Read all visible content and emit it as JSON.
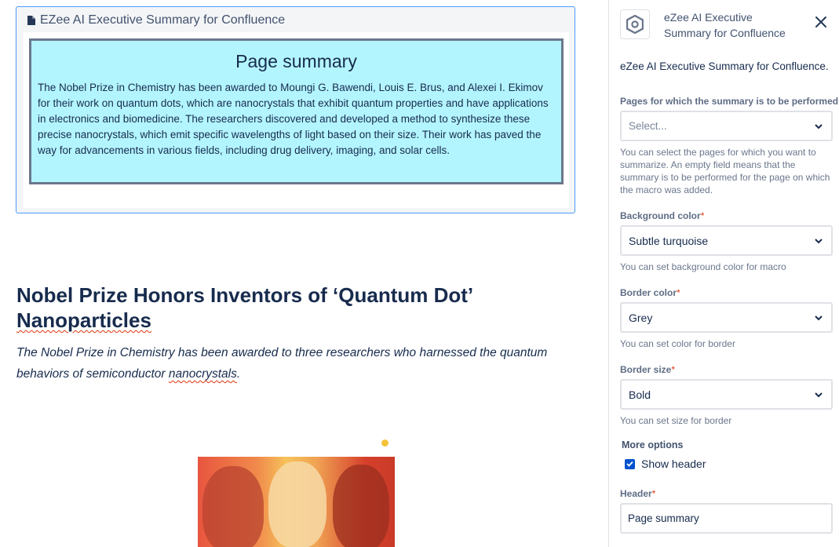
{
  "editor": {
    "macro_title": "EZee AI Executive Summary for Confluence",
    "summary_heading": "Page summary",
    "summary_text": "The Nobel Prize in Chemistry has been awarded to Moungi G. Bawendi, Louis E. Brus, and Alexei I. Ekimov for their work on quantum dots, which are nanocrystals that exhibit quantum properties and have applications in electronics and biomedicine. The researchers discovered and developed a method to synthesize these precise nanocrystals, which emit specific wavelengths of light based on their size. Their work has paved the way for advancements in various fields, including drug delivery, imaging, and solar cells.",
    "summary_bg_color": "#b3f5ff",
    "summary_border_color": "#6b778c",
    "article_title_part1": "Nobel Prize Honors Inventors of ‘Quantum Dot’",
    "article_title_part2": "Nanoparticles",
    "article_sub_part1": "The Nobel Prize in Chemistry has been awarded to three researchers who harnessed the quantum behaviors of semiconductor",
    "article_sub_part2": "nanocrystals",
    "article_sub_part3": "."
  },
  "panel": {
    "app_name": "eZee AI Executive Summary for Confluence",
    "app_description": "eZee AI Executive Summary for Confluence.",
    "icons": {
      "logo": "hexagon-logo-icon",
      "close": "close-icon",
      "chevron": "chevron-down-icon",
      "check": "checkmark-icon"
    },
    "pages_field": {
      "label": "Pages for which the summary is to be performed",
      "placeholder": "Select...",
      "helper": "You can select the pages for which you want to summarize. An empty field means that the summary is to be performed for the page on which the macro was added."
    },
    "background_field": {
      "label": "Background color",
      "required_mark": "*",
      "value": "Subtle turquoise",
      "helper": "You can set background color for macro"
    },
    "border_color_field": {
      "label": "Border color",
      "required_mark": "*",
      "value": "Grey",
      "helper": "You can set color for border"
    },
    "border_size_field": {
      "label": "Border size",
      "required_mark": "*",
      "value": "Bold",
      "helper": "You can set size for border"
    },
    "more_options": {
      "label": "More options",
      "show_header_label": "Show header",
      "show_header_checked": true
    },
    "header_field": {
      "label": "Header",
      "required_mark": "*",
      "value": "Page summary"
    }
  }
}
